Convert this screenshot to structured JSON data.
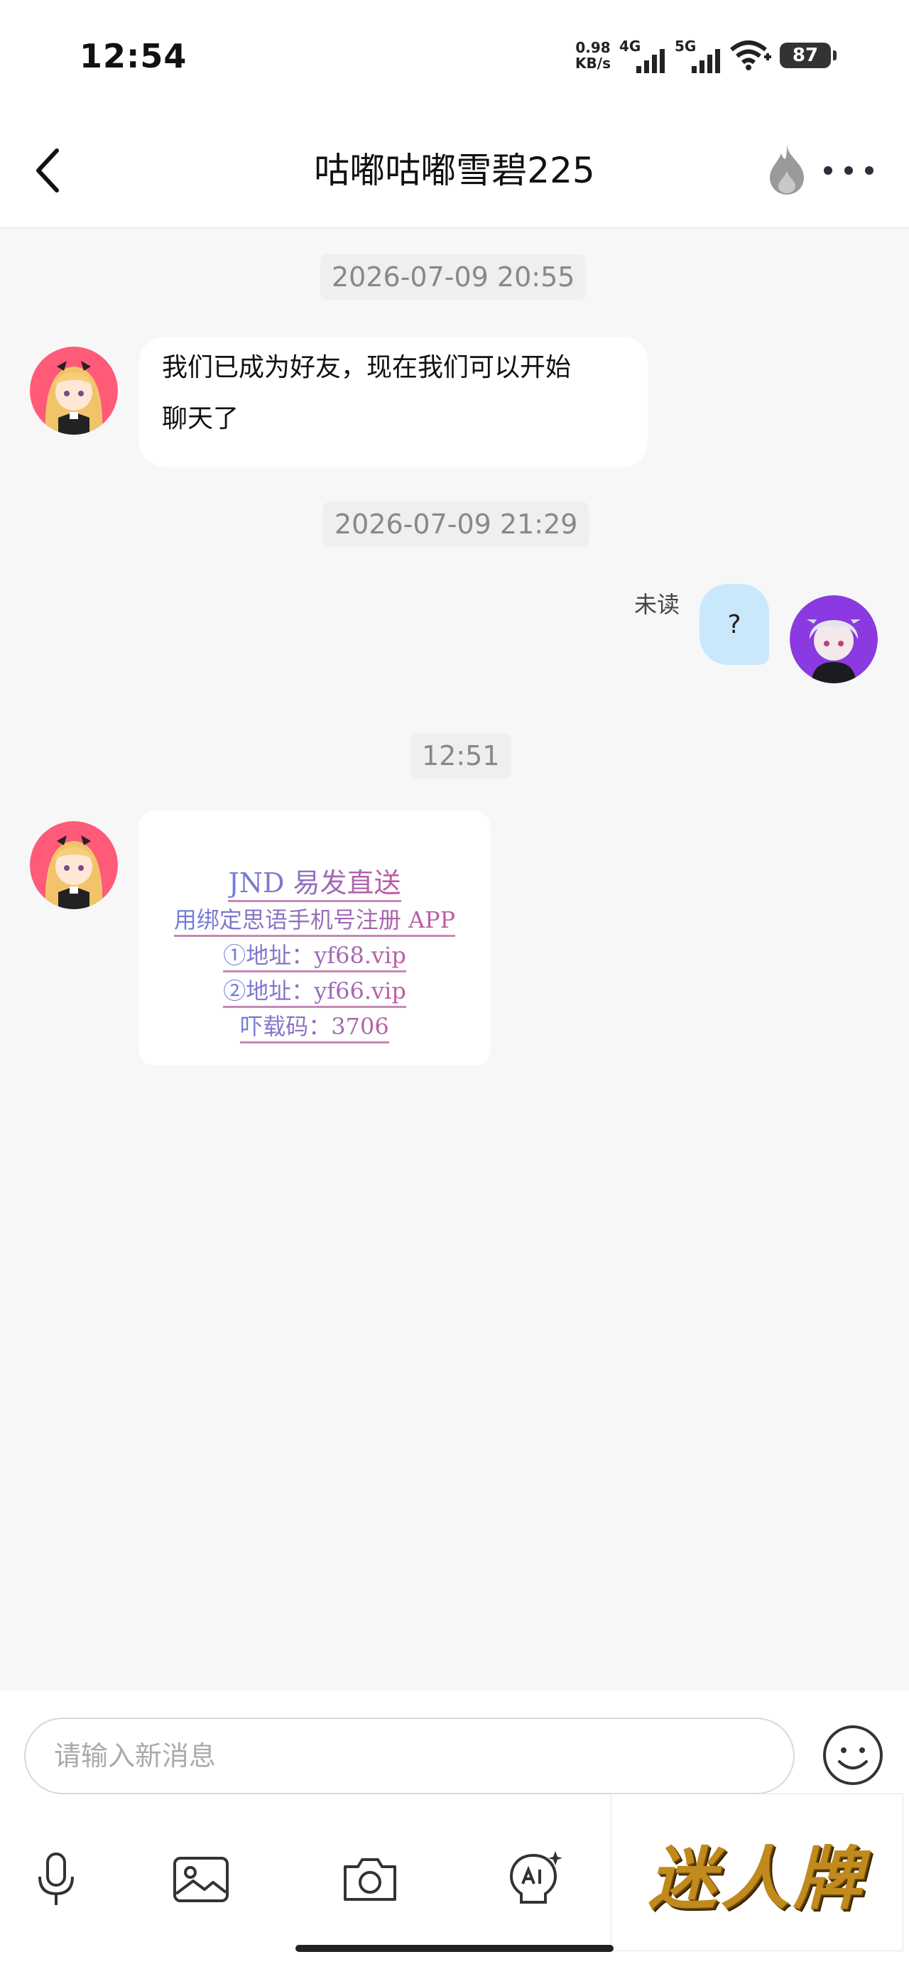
{
  "status_bar": {
    "time": "12:54",
    "net_speed_value": "0.98",
    "net_speed_unit": "KB/s",
    "sim1": "4G",
    "sim2": "5G",
    "battery": "87"
  },
  "header": {
    "title": "咕嘟咕嘟雪碧225"
  },
  "chat": {
    "timestamps": [
      "2026-07-09 20:55",
      "2026-07-09 21:29",
      "12:51"
    ],
    "system_message_line1": "我们已成为好友，现在我们可以开始",
    "system_message_line2": "聊天了",
    "my_message": "?",
    "my_message_status": "未读",
    "ad_lines": [
      "JND 易发直送",
      "用绑定思语手机号注册 APP",
      "①地址：yf68.vip",
      "②地址：yf66.vip",
      "吓载码：3706"
    ]
  },
  "composer": {
    "placeholder": "请输入新消息"
  },
  "watermark": {
    "text": "迷人牌"
  },
  "colors": {
    "my_bubble": "#c9e8fb",
    "chat_background": "#f7f7f7"
  }
}
